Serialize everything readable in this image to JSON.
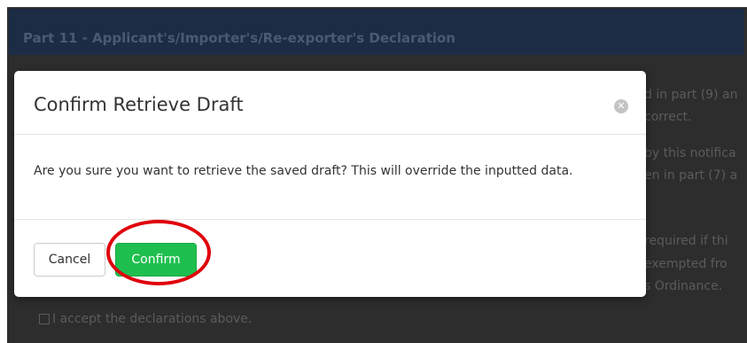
{
  "background": {
    "header_title": "Part 11 - Applicant's/Importer's/Re-exporter's Declaration",
    "lines": [
      "d in part (9) an",
      "correct.",
      "by this notifica",
      "en in part (7) a",
      "required if thi",
      "exempted fro",
      "s Ordinance."
    ],
    "checkbox_label": "I accept the declarations above."
  },
  "modal": {
    "title": "Confirm Retrieve Draft",
    "message": "Are you sure you want to retrieve the saved draft? This will override the inputted data.",
    "cancel_label": "Cancel",
    "confirm_label": "Confirm"
  },
  "colors": {
    "confirm": "#1fbf4f",
    "highlight": "#e0000b",
    "overlay": "#2d2d2d",
    "header": "#1c2c45"
  }
}
